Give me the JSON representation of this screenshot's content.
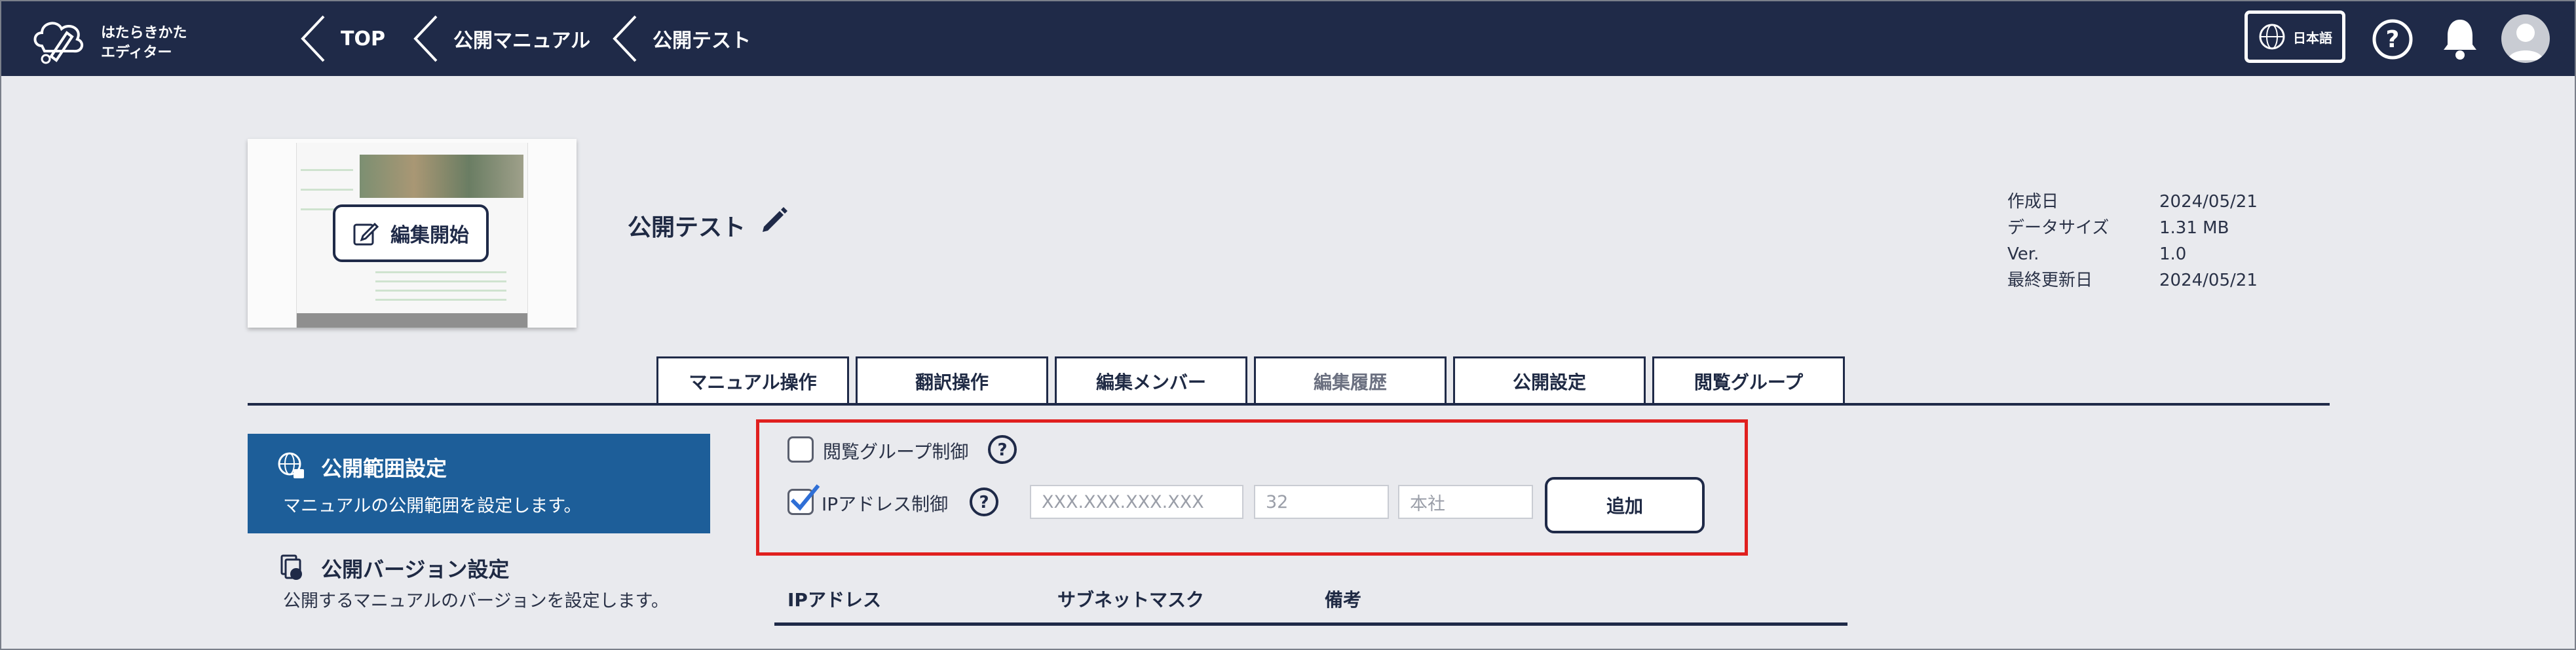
{
  "header": {
    "logo_line1": "はたらきかた",
    "logo_line2": "エディター",
    "breadcrumbs": [
      "TOP",
      "公開マニュアル",
      "公開テスト"
    ],
    "language_label": "日本語"
  },
  "document": {
    "title": "公開テスト",
    "edit_start_label": "編集開始",
    "meta": [
      {
        "key": "作成日",
        "value": "2024/05/21"
      },
      {
        "key": "データサイズ",
        "value": "1.31 MB"
      },
      {
        "key": "Ver.",
        "value": "1.0"
      },
      {
        "key": "最終更新日",
        "value": "2024/05/21"
      }
    ]
  },
  "tabs": [
    {
      "label": "マニュアル操作",
      "state": "normal"
    },
    {
      "label": "翻訳操作",
      "state": "normal"
    },
    {
      "label": "編集メンバー",
      "state": "normal"
    },
    {
      "label": "編集履歴",
      "state": "disabled"
    },
    {
      "label": "公開設定",
      "state": "active"
    },
    {
      "label": "閲覧グループ",
      "state": "normal"
    }
  ],
  "sidebar": {
    "items": [
      {
        "title": "公開範囲設定",
        "desc": "マニュアルの公開範囲を設定します。",
        "active": true
      },
      {
        "title": "公開バージョン設定",
        "desc": "公開するマニュアルのバージョンを設定します。",
        "active": false
      }
    ]
  },
  "settings": {
    "group_restriction": {
      "label": "閲覧グループ制御",
      "checked": false
    },
    "ip_restriction": {
      "label": "IPアドレス制御",
      "checked": true
    },
    "ip_placeholder": "XXX.XXX.XXX.XXX",
    "subnet_placeholder": "32",
    "note_placeholder": "本社",
    "add_label": "追加"
  },
  "table": {
    "headers": [
      "IPアドレス",
      "サブネットマスク",
      "備考"
    ]
  },
  "colors": {
    "header_bg": "#1f2a48",
    "active_side_bg": "#1d5e99",
    "highlight": "#e0201f",
    "check": "#2f6fd6"
  }
}
